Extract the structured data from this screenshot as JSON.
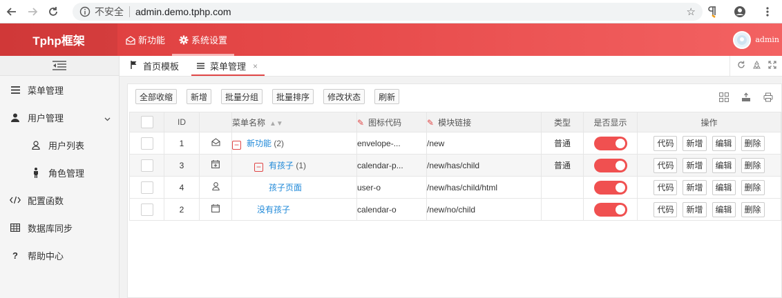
{
  "browser": {
    "insecure_label": "不安全",
    "url": "admin.demo.tphp.com"
  },
  "app": {
    "logo": "Tphp框架",
    "topnav": [
      {
        "label": "新功能",
        "icon": "envelope-open-icon"
      },
      {
        "label": "系统设置",
        "icon": "gear-icon"
      }
    ],
    "user": "admin",
    "accent": "#e84d4d"
  },
  "sidebar": {
    "items": [
      {
        "label": "菜单管理",
        "icon": "bars-icon"
      },
      {
        "label": "用户管理",
        "icon": "user-icon"
      },
      {
        "label": "用户列表",
        "icon": "user-outline-icon"
      },
      {
        "label": "角色管理",
        "icon": "male-icon"
      },
      {
        "label": "配置函数",
        "icon": "code-icon"
      },
      {
        "label": "数据库同步",
        "icon": "table-icon"
      },
      {
        "label": "帮助中心",
        "icon": "question-icon"
      }
    ]
  },
  "tabs": [
    {
      "label": "首页模板",
      "icon": "flag-icon"
    },
    {
      "label": "菜单管理",
      "icon": "bars-icon",
      "close": "×"
    }
  ],
  "toolbar": {
    "buttons": [
      "全部收缩",
      "新增",
      "批量分组",
      "批量排序",
      "修改状态",
      "刷新"
    ]
  },
  "table": {
    "headers": {
      "id": "ID",
      "name": "菜单名称",
      "icon_code": "图标代码",
      "module_link": "模块链接",
      "type": "类型",
      "visible": "是否显示",
      "actions": "操作"
    },
    "action_labels": [
      "代码",
      "新增",
      "编辑",
      "删除"
    ],
    "rows": [
      {
        "id": "1",
        "icon": "envelope-open-icon",
        "name": "新功能",
        "count": "(2)",
        "icon_code": "envelope-...",
        "link": "/new",
        "type": "普通",
        "visible": true
      },
      {
        "id": "3",
        "icon": "calendar-plus-icon",
        "name": "有孩子",
        "count": "(1)",
        "icon_code": "calendar-p...",
        "link": "/new/has/child",
        "type": "普通",
        "visible": true
      },
      {
        "id": "4",
        "icon": "user-outline-icon",
        "name": "孩子页面",
        "count": "",
        "icon_code": "user-o",
        "link": "/new/has/child/html",
        "type": "",
        "visible": true
      },
      {
        "id": "2",
        "icon": "calendar-icon",
        "name": "没有孩子",
        "count": "",
        "icon_code": "calendar-o",
        "link": "/new/no/child",
        "type": "",
        "visible": true
      }
    ]
  }
}
